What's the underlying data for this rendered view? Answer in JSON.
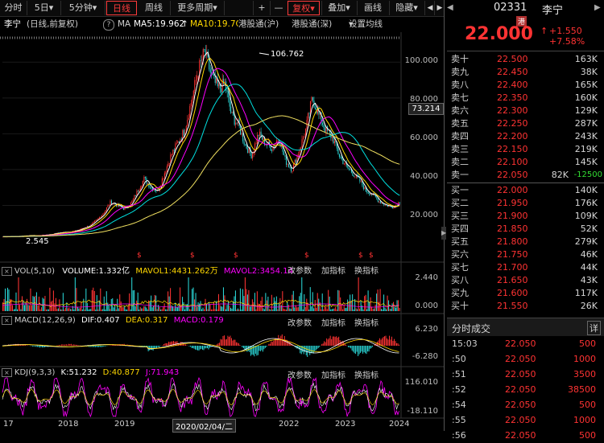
{
  "tabs": [
    {
      "label": "分时"
    },
    {
      "label": "5日",
      "arrow": "▾"
    },
    {
      "label": "5分钟",
      "arrow": "▾"
    },
    {
      "label": "日线",
      "active": true
    },
    {
      "label": "周线"
    },
    {
      "label": "更多周期",
      "arrow": "▾"
    }
  ],
  "toolbar": {
    "plus": "+",
    "minus": "—",
    "fuquan": "复权",
    "fuquan_arrow": "▾",
    "diejia": "叠加",
    "diejia_arrow": "▾",
    "huaxian": "画线",
    "yincang": "隐藏",
    "yincang_arrow": "▾",
    "prev": "◀",
    "next": "▶"
  },
  "header": {
    "name": "李宁",
    "mode": "(日线,前复权)",
    "ma_label": "MA",
    "ma5": "MA5:19.962",
    "ma5_arrow": "↑",
    "ma10": "MA10:19.7C",
    "connect": "港股通(沪)",
    "connect2": "港股通(深)",
    "setting": "设置均线",
    "setting_arrow": "▾"
  },
  "stock": {
    "code": "02331",
    "name": "李宁",
    "market_badge": "港",
    "price": "22.000",
    "change": "+1.550",
    "change_pct": "+7.58%",
    "up_arrow": "↑"
  },
  "price_axis": [
    "100.000",
    "80.000",
    "60.000",
    "40.000",
    "20.000"
  ],
  "current_price_tag": "73.214",
  "annotations": {
    "high": "106.762",
    "low": "2.545"
  },
  "years": [
    "17",
    "2018",
    "2019",
    "2022",
    "2023",
    "2024"
  ],
  "crosshair_date": "2020/02/04/二",
  "vol": {
    "title": "VOL(5,10)",
    "volume": "VOLUME:1.332亿",
    "ma1": "MAVOL1:4431.262万",
    "ma2": "MAVOL2:3454.14",
    "axis_top": "2.440",
    "axis_bottom": "0.000",
    "edit": "改参数",
    "add": "加指标",
    "swap": "换指标"
  },
  "macd": {
    "title": "MACD(12,26,9)",
    "dif": "DIF:0.407",
    "dea": "DEA:0.317",
    "macd": "MACD:0.179",
    "axis_top": "6.230",
    "axis_bottom": "-6.280",
    "edit": "改参数",
    "add": "加指标",
    "swap": "换指标"
  },
  "kdj": {
    "title": "KDJ(9,3,3)",
    "k": "K:51.232",
    "d": "D:40.877",
    "j": "J:71.943",
    "axis_top": "116.010",
    "axis_bottom": "-18.110",
    "edit": "改参数",
    "add": "加指标",
    "swap": "换指标"
  },
  "sell": [
    {
      "label": "卖十",
      "price": "22.500",
      "vol": "163K"
    },
    {
      "label": "卖九",
      "price": "22.450",
      "vol": "38K"
    },
    {
      "label": "卖八",
      "price": "22.400",
      "vol": "165K"
    },
    {
      "label": "卖七",
      "price": "22.350",
      "vol": "160K"
    },
    {
      "label": "卖六",
      "price": "22.300",
      "vol": "129K"
    },
    {
      "label": "卖五",
      "price": "22.250",
      "vol": "287K"
    },
    {
      "label": "卖四",
      "price": "22.200",
      "vol": "243K"
    },
    {
      "label": "卖三",
      "price": "22.150",
      "vol": "219K"
    },
    {
      "label": "卖二",
      "price": "22.100",
      "vol": "145K"
    },
    {
      "label": "卖一",
      "price": "22.050",
      "vol": "82K",
      "extra": "-12500"
    }
  ],
  "buy": [
    {
      "label": "买一",
      "price": "22.000",
      "vol": "140K"
    },
    {
      "label": "买二",
      "price": "21.950",
      "vol": "176K"
    },
    {
      "label": "买三",
      "price": "21.900",
      "vol": "109K"
    },
    {
      "label": "买四",
      "price": "21.850",
      "vol": "52K"
    },
    {
      "label": "买五",
      "price": "21.800",
      "vol": "279K"
    },
    {
      "label": "买六",
      "price": "21.750",
      "vol": "46K"
    },
    {
      "label": "买七",
      "price": "21.700",
      "vol": "44K"
    },
    {
      "label": "买八",
      "price": "21.650",
      "vol": "43K"
    },
    {
      "label": "买九",
      "price": "21.600",
      "vol": "117K"
    },
    {
      "label": "买十",
      "price": "21.550",
      "vol": "26K"
    }
  ],
  "ticks_title": "分时成交",
  "ticks_detail": "详",
  "ticks": [
    {
      "time": "15:03",
      "price": "22.050",
      "vol": "500"
    },
    {
      "time": ":50",
      "price": "22.050",
      "vol": "1000"
    },
    {
      "time": ":51",
      "price": "22.050",
      "vol": "3500"
    },
    {
      "time": ":52",
      "price": "22.050",
      "vol": "38500"
    },
    {
      "time": ":54",
      "price": "22.050",
      "vol": "500"
    },
    {
      "time": ":55",
      "price": "22.050",
      "vol": "1000"
    },
    {
      "time": ":56",
      "price": "22.050",
      "vol": "500"
    }
  ],
  "colors": {
    "up": "#ff3333",
    "down": "#2ad6d6",
    "ma5": "#ffffff",
    "ma10": "#ffd800",
    "ma20": "#ff00ff",
    "ma60": "#00e0e0",
    "ma120": "#f0e060",
    "accent": "#ff3b3b"
  },
  "chart_data": {
    "type": "candlestick",
    "title": "李宁 (日线,前复权)",
    "y_axis": [
      20,
      40,
      60,
      80,
      100
    ],
    "high": 106.762,
    "low": 2.545,
    "close_series": [
      2.5,
      2.6,
      2.7,
      2.9,
      3.2,
      3.0,
      3.4,
      3.8,
      4.5,
      5.0,
      5.3,
      6.0,
      7.5,
      9.0,
      12,
      16,
      22,
      20,
      18,
      21,
      28,
      35,
      30,
      28,
      38,
      48,
      55,
      62,
      78,
      95,
      106,
      92,
      85,
      88,
      70,
      65,
      54,
      48,
      60,
      55,
      52,
      58,
      45,
      40,
      50,
      62,
      80,
      70,
      62,
      58,
      48,
      42,
      38,
      34,
      28,
      26,
      22,
      20,
      19,
      22
    ]
  }
}
